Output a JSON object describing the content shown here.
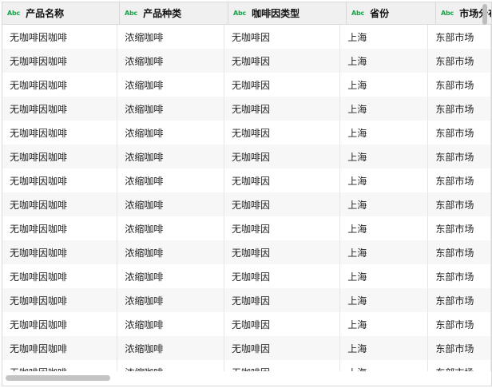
{
  "table": {
    "columns": [
      {
        "type_icon": "Abc",
        "label": "产品名称"
      },
      {
        "type_icon": "Abc",
        "label": "产品种类"
      },
      {
        "type_icon": "Abc",
        "label": "咖啡因类型"
      },
      {
        "type_icon": "Abc",
        "label": "省份"
      },
      {
        "type_icon": "Abc",
        "label": "市场分布"
      }
    ],
    "rows": [
      [
        "无咖啡因咖啡",
        "浓缩咖啡",
        "无咖啡因",
        "上海",
        "东部市场"
      ],
      [
        "无咖啡因咖啡",
        "浓缩咖啡",
        "无咖啡因",
        "上海",
        "东部市场"
      ],
      [
        "无咖啡因咖啡",
        "浓缩咖啡",
        "无咖啡因",
        "上海",
        "东部市场"
      ],
      [
        "无咖啡因咖啡",
        "浓缩咖啡",
        "无咖啡因",
        "上海",
        "东部市场"
      ],
      [
        "无咖啡因咖啡",
        "浓缩咖啡",
        "无咖啡因",
        "上海",
        "东部市场"
      ],
      [
        "无咖啡因咖啡",
        "浓缩咖啡",
        "无咖啡因",
        "上海",
        "东部市场"
      ],
      [
        "无咖啡因咖啡",
        "浓缩咖啡",
        "无咖啡因",
        "上海",
        "东部市场"
      ],
      [
        "无咖啡因咖啡",
        "浓缩咖啡",
        "无咖啡因",
        "上海",
        "东部市场"
      ],
      [
        "无咖啡因咖啡",
        "浓缩咖啡",
        "无咖啡因",
        "上海",
        "东部市场"
      ],
      [
        "无咖啡因咖啡",
        "浓缩咖啡",
        "无咖啡因",
        "上海",
        "东部市场"
      ],
      [
        "无咖啡因咖啡",
        "浓缩咖啡",
        "无咖啡因",
        "上海",
        "东部市场"
      ],
      [
        "无咖啡因咖啡",
        "浓缩咖啡",
        "无咖啡因",
        "上海",
        "东部市场"
      ],
      [
        "无咖啡因咖啡",
        "浓缩咖啡",
        "无咖啡因",
        "上海",
        "东部市场"
      ],
      [
        "无咖啡因咖啡",
        "浓缩咖啡",
        "无咖啡因",
        "上海",
        "东部市场"
      ],
      [
        "无咖啡因咖啡",
        "浓缩咖啡",
        "无咖啡因",
        "上海",
        "东部市场"
      ]
    ]
  },
  "colors": {
    "type_icon": "#1aa34a",
    "header_bg": "#f0f0f0",
    "row_alt_bg": "#f7f7f7",
    "border": "#d9d9d9"
  }
}
